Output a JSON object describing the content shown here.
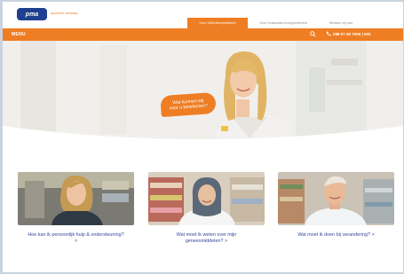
{
  "header": {
    "logo_text": "pma",
    "tagline": "apotheek vandaag",
    "tabs": [
      {
        "label": "Voor Cliënten/patiënten"
      },
      {
        "label": "Voor Huisartsen/zorgverleners"
      },
      {
        "label": "Werken bij ons"
      }
    ]
  },
  "menubar": {
    "menu_label": "MENU",
    "phone": "088 07 00 7000 | 000"
  },
  "hero": {
    "bubble_text": "Wat kunnen wij\nvoor u betekenen?"
  },
  "cards": [
    {
      "caption": "Hoe kan ik persoonlijk hulp & ondersteuning? >"
    },
    {
      "caption": "Wat moet ik weten over mijn geneesmiddelen? >"
    },
    {
      "caption": "Wat moet ik doen bij verandering? >"
    }
  ],
  "colors": {
    "accent": "#ee7d23",
    "brand": "#1f3f8f",
    "link": "#36489a"
  }
}
